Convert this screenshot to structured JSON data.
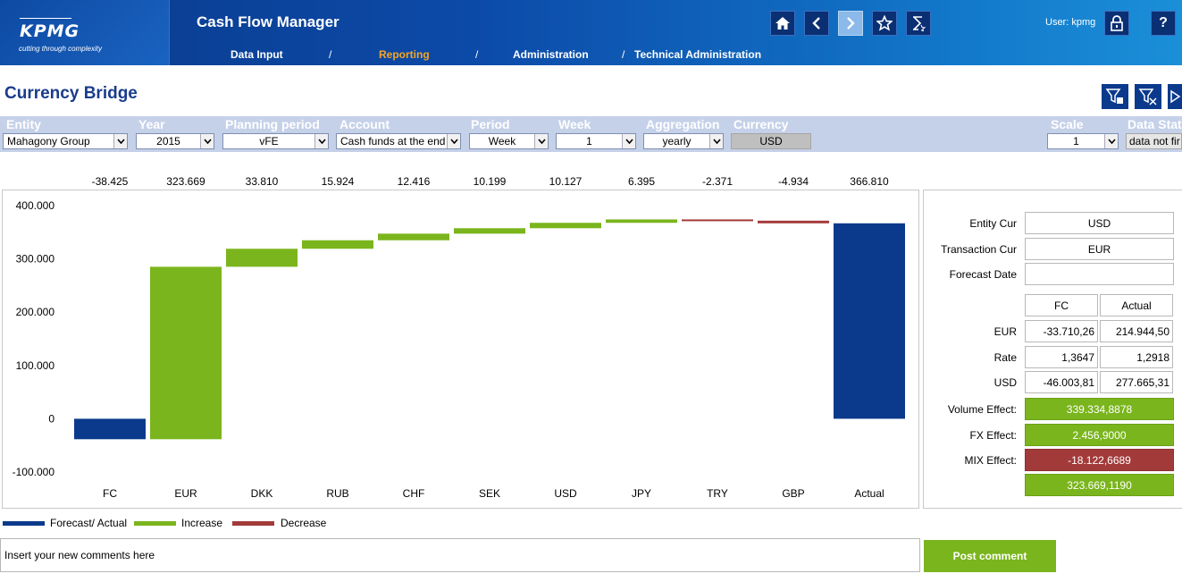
{
  "header": {
    "brand": "KPMG",
    "tagline": "cutting through complexity",
    "app_title": "Cash Flow Manager",
    "nav": [
      "Data Input",
      "Reporting",
      "Administration",
      "Technical Administration"
    ],
    "nav_active": "Reporting",
    "user_label": "User: kpmg",
    "help_label": "?",
    "icons": [
      "home-icon",
      "back-icon",
      "forward-icon",
      "favorite-icon",
      "hourglass-icon",
      "lock-icon",
      "help-icon"
    ]
  },
  "page": {
    "title": "Currency Bridge"
  },
  "filters": {
    "entity": {
      "label": "Entity",
      "value": "Mahagony Group"
    },
    "year": {
      "label": "Year",
      "value": "2015"
    },
    "planning_period": {
      "label": "Planning period",
      "value": "vFE"
    },
    "account": {
      "label": "Account",
      "value": "Cash funds at the end"
    },
    "period": {
      "label": "Period",
      "value": "Week"
    },
    "week": {
      "label": "Week",
      "value": "1"
    },
    "aggregation": {
      "label": "Aggregation",
      "value": "yearly"
    },
    "currency": {
      "label": "Currency",
      "value": "USD"
    },
    "scale": {
      "label": "Scale",
      "value": "1"
    },
    "data_status": {
      "label": "Data Statu",
      "value": "data not fir"
    }
  },
  "chart_data": {
    "type": "bar",
    "subtype": "waterfall",
    "categories": [
      "FC",
      "EUR",
      "DKK",
      "RUB",
      "CHF",
      "SEK",
      "USD",
      "JPY",
      "TRY",
      "GBP",
      "Actual"
    ],
    "values": [
      -38.425,
      323.669,
      33.81,
      15.924,
      12.416,
      10.199,
      10.127,
      6.395,
      -2.371,
      -4.934,
      366.81
    ],
    "value_labels": [
      "-38.425",
      "323.669",
      "33.810",
      "15.924",
      "12.416",
      "10.199",
      "10.127",
      "6.395",
      "-2.371",
      "-4.934",
      "366.810"
    ],
    "kinds": [
      "total",
      "increase",
      "increase",
      "increase",
      "increase",
      "increase",
      "increase",
      "increase",
      "decrease",
      "decrease",
      "total"
    ],
    "ylim": [
      -100000,
      400000
    ],
    "yticks": [
      400000,
      300000,
      200000,
      100000,
      0,
      -100000
    ],
    "ytick_labels": [
      "400.000",
      "300.000",
      "200.000",
      "100.000",
      "0",
      "-100.000"
    ],
    "colors": {
      "total": "#0b3a8c",
      "increase": "#7ab51d",
      "decrease": "#a33a3a"
    },
    "legend": [
      "Forecast/ Actual",
      "Increase",
      "Decrease"
    ],
    "grid": false
  },
  "panel": {
    "entity_cur_label": "Entity Cur",
    "entity_cur": "USD",
    "transaction_cur_label": "Transaction Cur",
    "transaction_cur": "EUR",
    "forecast_date_label": "Forecast Date",
    "forecast_date": "",
    "col_fc": "FC",
    "col_actual": "Actual",
    "rows": [
      {
        "label": "EUR",
        "fc": "-33.710,26",
        "actual": "214.944,50"
      },
      {
        "label": "Rate",
        "fc": "1,3647",
        "actual": "1,2918"
      },
      {
        "label": "USD",
        "fc": "-46.003,81",
        "actual": "277.665,31"
      }
    ],
    "volume_effect_label": "Volume Effect:",
    "volume_effect": "339.334,8878",
    "fx_effect_label": "FX Effect:",
    "fx_effect": "2.456,9000",
    "mix_effect_label": "MIX Effect:",
    "mix_effect": "-18.122,6689",
    "total_effect": "323.669,1190"
  },
  "comment": {
    "placeholder": "Insert your new comments here",
    "post_label": "Post comment"
  }
}
